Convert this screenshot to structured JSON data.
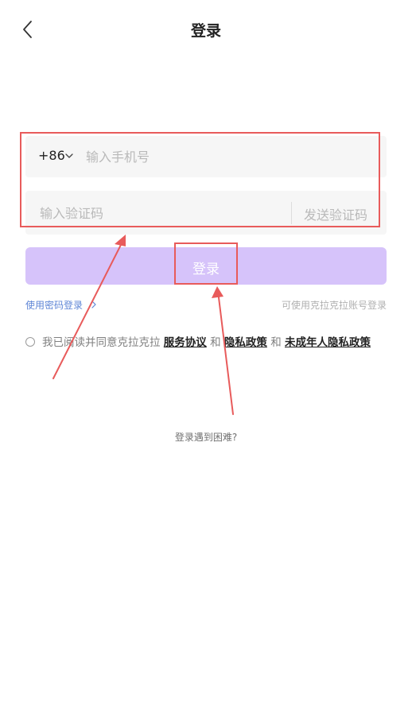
{
  "header": {
    "back_icon": "chevron-left-icon",
    "title": "登录"
  },
  "phone": {
    "country_code": "+86",
    "country_chevron_icon": "chevron-down-icon",
    "placeholder": "输入手机号",
    "value": ""
  },
  "code": {
    "placeholder": "输入验证码",
    "value": "",
    "send_label": "发送验证码"
  },
  "login_button": {
    "label": "登录",
    "color": "#d6c3fa"
  },
  "links": {
    "password_login": "使用密码登录",
    "password_chevron_icon": "chevron-right-icon",
    "other_account": "可使用克拉克拉账号登录"
  },
  "agreement": {
    "checked": false,
    "prefix": "我已阅读并同意克拉克拉",
    "service": "服务协议",
    "and1": "和",
    "privacy": "隐私政策",
    "and2": "和",
    "minor_privacy": "未成年人隐私政策"
  },
  "help": {
    "trouble": "登录遇到困难?"
  },
  "colors": {
    "accent_link": "#5f86d6",
    "annotation": "#e85b5b"
  }
}
